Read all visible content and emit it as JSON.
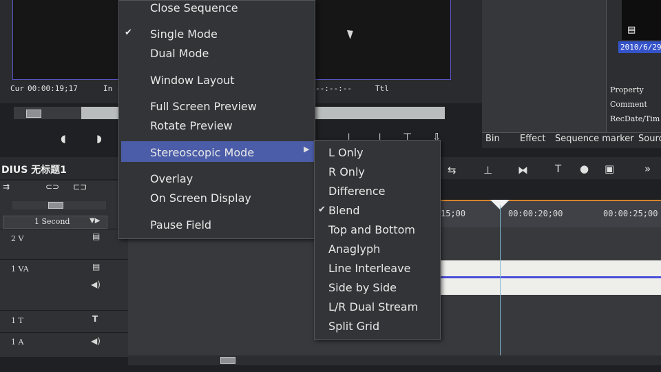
{
  "preview": {
    "cur_label": "Cur",
    "cur_time": "00:00:19;17",
    "in_label": "In -",
    "out_time": "--:--:--",
    "ttl_label": "Ttl"
  },
  "main_menu": {
    "items": [
      {
        "label": "Close Sequence",
        "checked": false
      },
      {
        "label": "Single Mode",
        "checked": true
      },
      {
        "label": "Dual Mode",
        "checked": false
      },
      {
        "label": "Window Layout",
        "checked": false
      },
      {
        "label": "Full Screen Preview",
        "checked": false
      },
      {
        "label": "Rotate Preview",
        "checked": false
      },
      {
        "label": "Stereoscopic Mode",
        "checked": false,
        "highlighted": true
      },
      {
        "label": "Overlay",
        "checked": false
      },
      {
        "label": "On Screen Display",
        "checked": false
      },
      {
        "label": "Pause Field",
        "checked": false
      }
    ]
  },
  "sub_menu": {
    "items": [
      {
        "label": "L Only",
        "checked": false
      },
      {
        "label": "R Only",
        "checked": false
      },
      {
        "label": "Difference",
        "checked": false
      },
      {
        "label": "Blend",
        "checked": true
      },
      {
        "label": "Top and Bottom",
        "checked": false
      },
      {
        "label": "Anaglyph",
        "checked": false
      },
      {
        "label": "Line Interleave",
        "checked": false
      },
      {
        "label": "Side by Side",
        "checked": false
      },
      {
        "label": "L/R Dual Stream",
        "checked": false
      },
      {
        "label": "Split Grid",
        "checked": false
      }
    ]
  },
  "check_mark": "✔",
  "bin": {
    "date": "2010/6/29",
    "properties": [
      "Property",
      "Comment",
      "RecDate/Tim"
    ],
    "tabs": [
      "Bin",
      "Effect",
      "Sequence marker",
      "Sourc"
    ]
  },
  "timeline": {
    "title": "DIUS 无标题1",
    "zoom_label": "1 Second",
    "ruler_ticks": [
      "15;00",
      "00:00:20;00",
      "00:00:25;00"
    ],
    "tracks": [
      "2 V",
      "1 VA",
      "1 T",
      "1 A"
    ]
  },
  "colors": {
    "monitor_border": "#5a55c8",
    "menu_highlight": "#4b5da8",
    "ruler_accent": "#d8822c",
    "date_highlight": "#3553c9"
  }
}
